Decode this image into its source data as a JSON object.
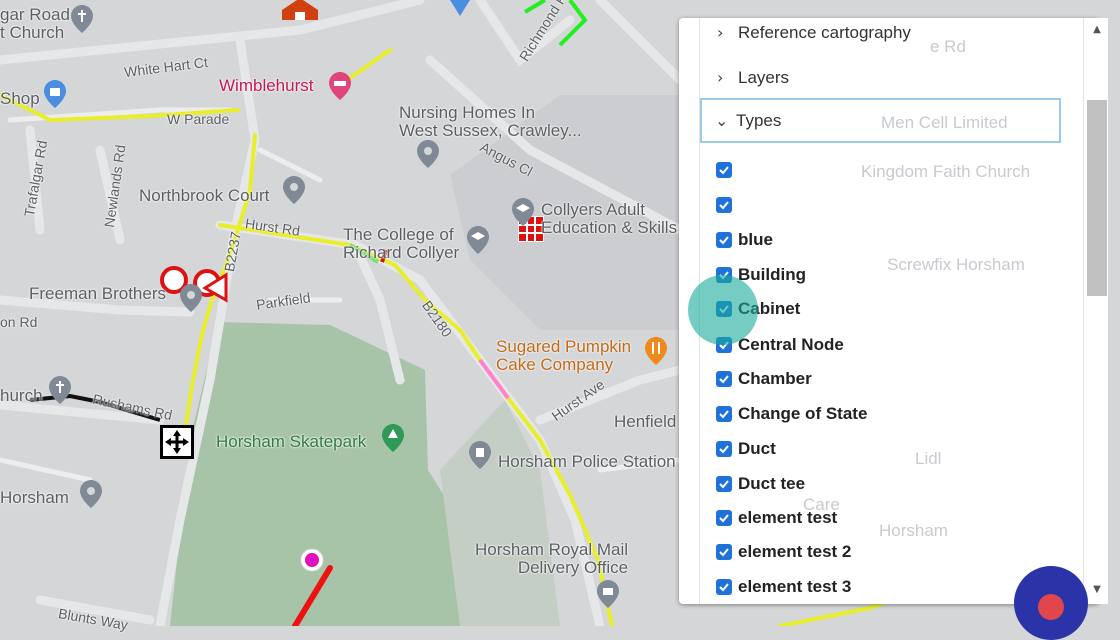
{
  "map": {
    "labels": {
      "church": "gar Road\nt Church",
      "white_hart": "White Hart Ct",
      "wimblehurst": "Wimblehurst",
      "shop": "Shop",
      "w_parade": "W Parade",
      "richmond": "Richmond Rd",
      "nursing": "Nursing Homes In\nWest Sussex, Crawley...",
      "angus": "Angus Cl",
      "trafalgar": "Trafalgar Rd",
      "newlands": "Newlands Rd",
      "northbrook": "Northbrook Court",
      "hurst_rd": "Hurst Rd",
      "college": "The College of\nRichard Collyer",
      "collyers": "Collyers Adult\nEducation & Skills",
      "freeman": "Freeman Brothers",
      "parkfield": "Parkfield",
      "on_rd": "on Rd",
      "b2237": "B2237",
      "b2180": "B2180",
      "sugared": "Sugared Pumpkin\nCake Company",
      "hurst_ave": "Hurst Ave",
      "henfield": "Henfield",
      "hurch": "hurch",
      "rushams": "Rushams Rd",
      "skatepark": "Horsham Skatepark",
      "police": "Horsham Police Station",
      "horsham": "Horsham",
      "royal_mail": "Horsham Royal Mail\nDelivery Office",
      "blunts": "Blunts Way"
    },
    "faded_labels": {
      "rd": "e Rd",
      "men_cell": "Men Cell Limited",
      "kingdom": "Kingdom Faith Church",
      "screwfix": "Screwfix Horsham",
      "lidl": "Lidl",
      "horsham2": "Horsham",
      "care": "Care"
    }
  },
  "panel": {
    "sections": [
      {
        "label": "Reference cartography",
        "expanded": false
      },
      {
        "label": "Layers",
        "expanded": false
      },
      {
        "label": "Types",
        "expanded": true
      }
    ],
    "types": [
      {
        "label": "",
        "checked": true
      },
      {
        "label": "",
        "checked": true
      },
      {
        "label": "blue",
        "checked": true
      },
      {
        "label": "Building",
        "checked": true
      },
      {
        "label": "Cabinet",
        "checked": true
      },
      {
        "label": "Central Node",
        "checked": true
      },
      {
        "label": "Chamber",
        "checked": true
      },
      {
        "label": "Change of State",
        "checked": true
      },
      {
        "label": "Duct",
        "checked": true
      },
      {
        "label": "Duct tee",
        "checked": true
      },
      {
        "label": "element test",
        "checked": true
      },
      {
        "label": "element test 2",
        "checked": true
      },
      {
        "label": "element test 3",
        "checked": true
      }
    ]
  },
  "icons": {
    "chevron_collapsed": "chevron-right-icon",
    "chevron_expanded": "chevron-down-icon",
    "checkbox": "checkbox-checked-icon",
    "fab": "record-icon"
  },
  "colors": {
    "checkbox": "#1f73d8",
    "fab": "#2b33a8",
    "fab_dot": "#e0474c",
    "route_yellow": "#e8ee2a",
    "cable_red": "#ee1111",
    "ripple": "#17aa9b"
  }
}
